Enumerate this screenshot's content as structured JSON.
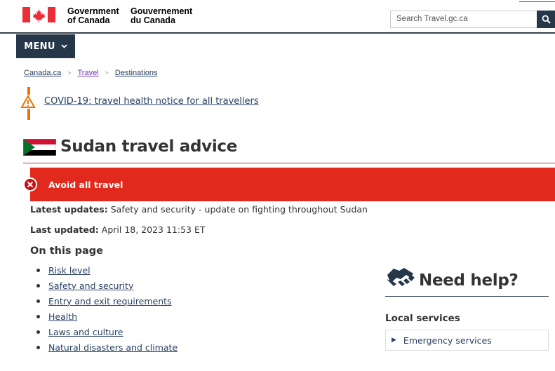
{
  "header": {
    "gov_en_line1": "Government",
    "gov_en_line2": "of Canada",
    "gov_fr_line1": "Gouvernement",
    "gov_fr_line2": "du Canada",
    "search_placeholder": "Search Travel.gc.ca",
    "brand_color": "#26374a",
    "flag_color": "#eb2d37"
  },
  "menu": {
    "label": "MENU"
  },
  "breadcrumb": {
    "items": [
      "Canada.ca",
      "Travel",
      "Destinations"
    ]
  },
  "notice": {
    "icon": "warning-icon",
    "text": "COVID-19: travel health notice for all travellers"
  },
  "page": {
    "title": "Sudan travel advice",
    "flag_icon": "sudan-flag"
  },
  "alert": {
    "text": "Avoid all travel",
    "color": "#e1291d"
  },
  "latest": {
    "label": "Latest updates:",
    "value": " Safety and security - update on fighting throughout Sudan"
  },
  "updated": {
    "label": "Last updated:",
    "value": " April 18, 2023 11:53 ET"
  },
  "on_this_page": {
    "heading": "On this page",
    "items": [
      "Risk level",
      "Safety and security",
      "Entry and exit requirements",
      "Health",
      "Laws and culture",
      "Natural disasters and climate"
    ]
  },
  "help": {
    "title": "Need help?",
    "icon": "handshake-icon",
    "local_heading": "Local services",
    "emergency_label": "Emergency services"
  }
}
